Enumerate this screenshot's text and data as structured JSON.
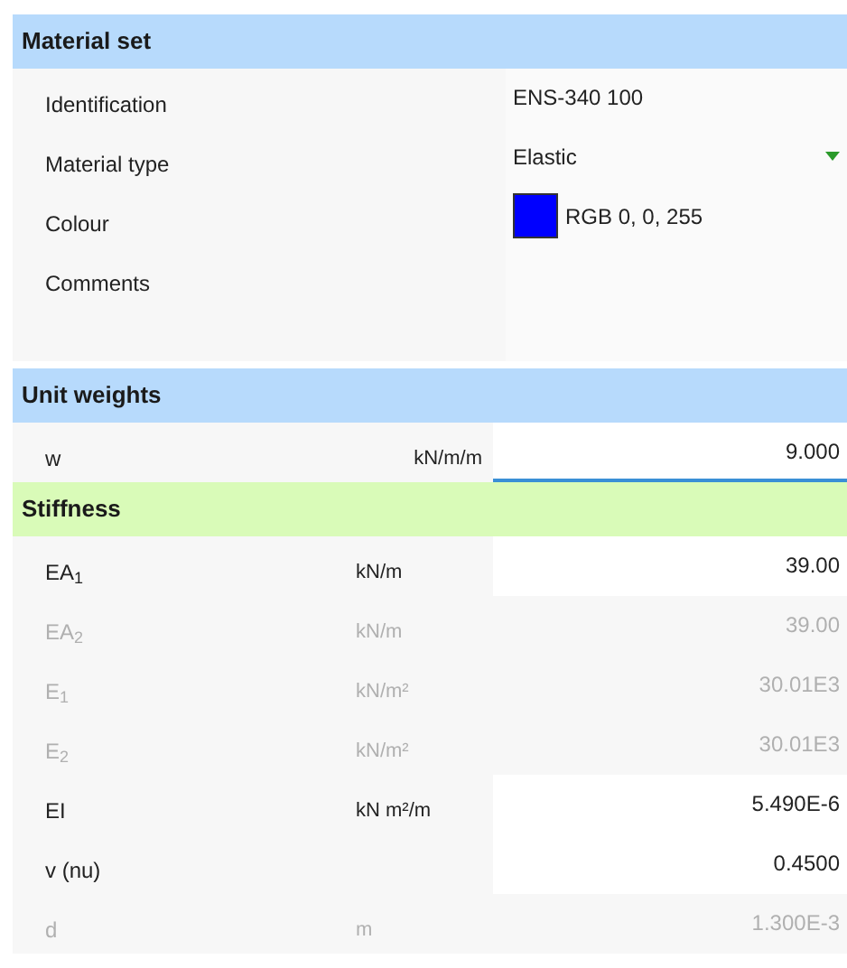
{
  "material_set": {
    "title": "Material set",
    "rows": [
      {
        "kind": "text",
        "label": "Identification",
        "value": "ENS-340 100"
      },
      {
        "kind": "dropdown",
        "label": "Material type",
        "value": "Elastic"
      },
      {
        "kind": "color",
        "label": "Colour",
        "value": "RGB 0, 0, 255",
        "color": "#0000ff"
      },
      {
        "kind": "memo",
        "label": "Comments"
      }
    ]
  },
  "unit_weights": {
    "title": "Unit weights",
    "rows": [
      {
        "label": "w",
        "unit": "kN/m/m",
        "value": "9.000",
        "disabled": false,
        "focused": true
      }
    ]
  },
  "stiffness": {
    "title": "Stiffness",
    "rows": [
      {
        "label": "EA$_{1}$",
        "unit": "kN/m",
        "value": "39.00",
        "disabled": false,
        "focused": false
      },
      {
        "label": "EA$_{2}$",
        "unit": "kN/m",
        "value": "39.00",
        "disabled": true,
        "focused": false
      },
      {
        "label": "E$_{1}$",
        "unit": "kN/m²",
        "value": "30.01E3",
        "disabled": true,
        "focused": false
      },
      {
        "label": "E$_{2}$",
        "unit": "kN/m²",
        "value": "30.01E3",
        "disabled": true,
        "focused": false
      },
      {
        "label": "EI",
        "unit": "kN m²/m",
        "value": "5.490E-6",
        "disabled": false,
        "focused": false
      },
      {
        "label": "v (nu)",
        "value": "0.4500",
        "disabled": false,
        "focused": false
      },
      {
        "label": "d",
        "unit": "m",
        "value": "1.300E-3",
        "disabled": true,
        "focused": false
      }
    ]
  }
}
